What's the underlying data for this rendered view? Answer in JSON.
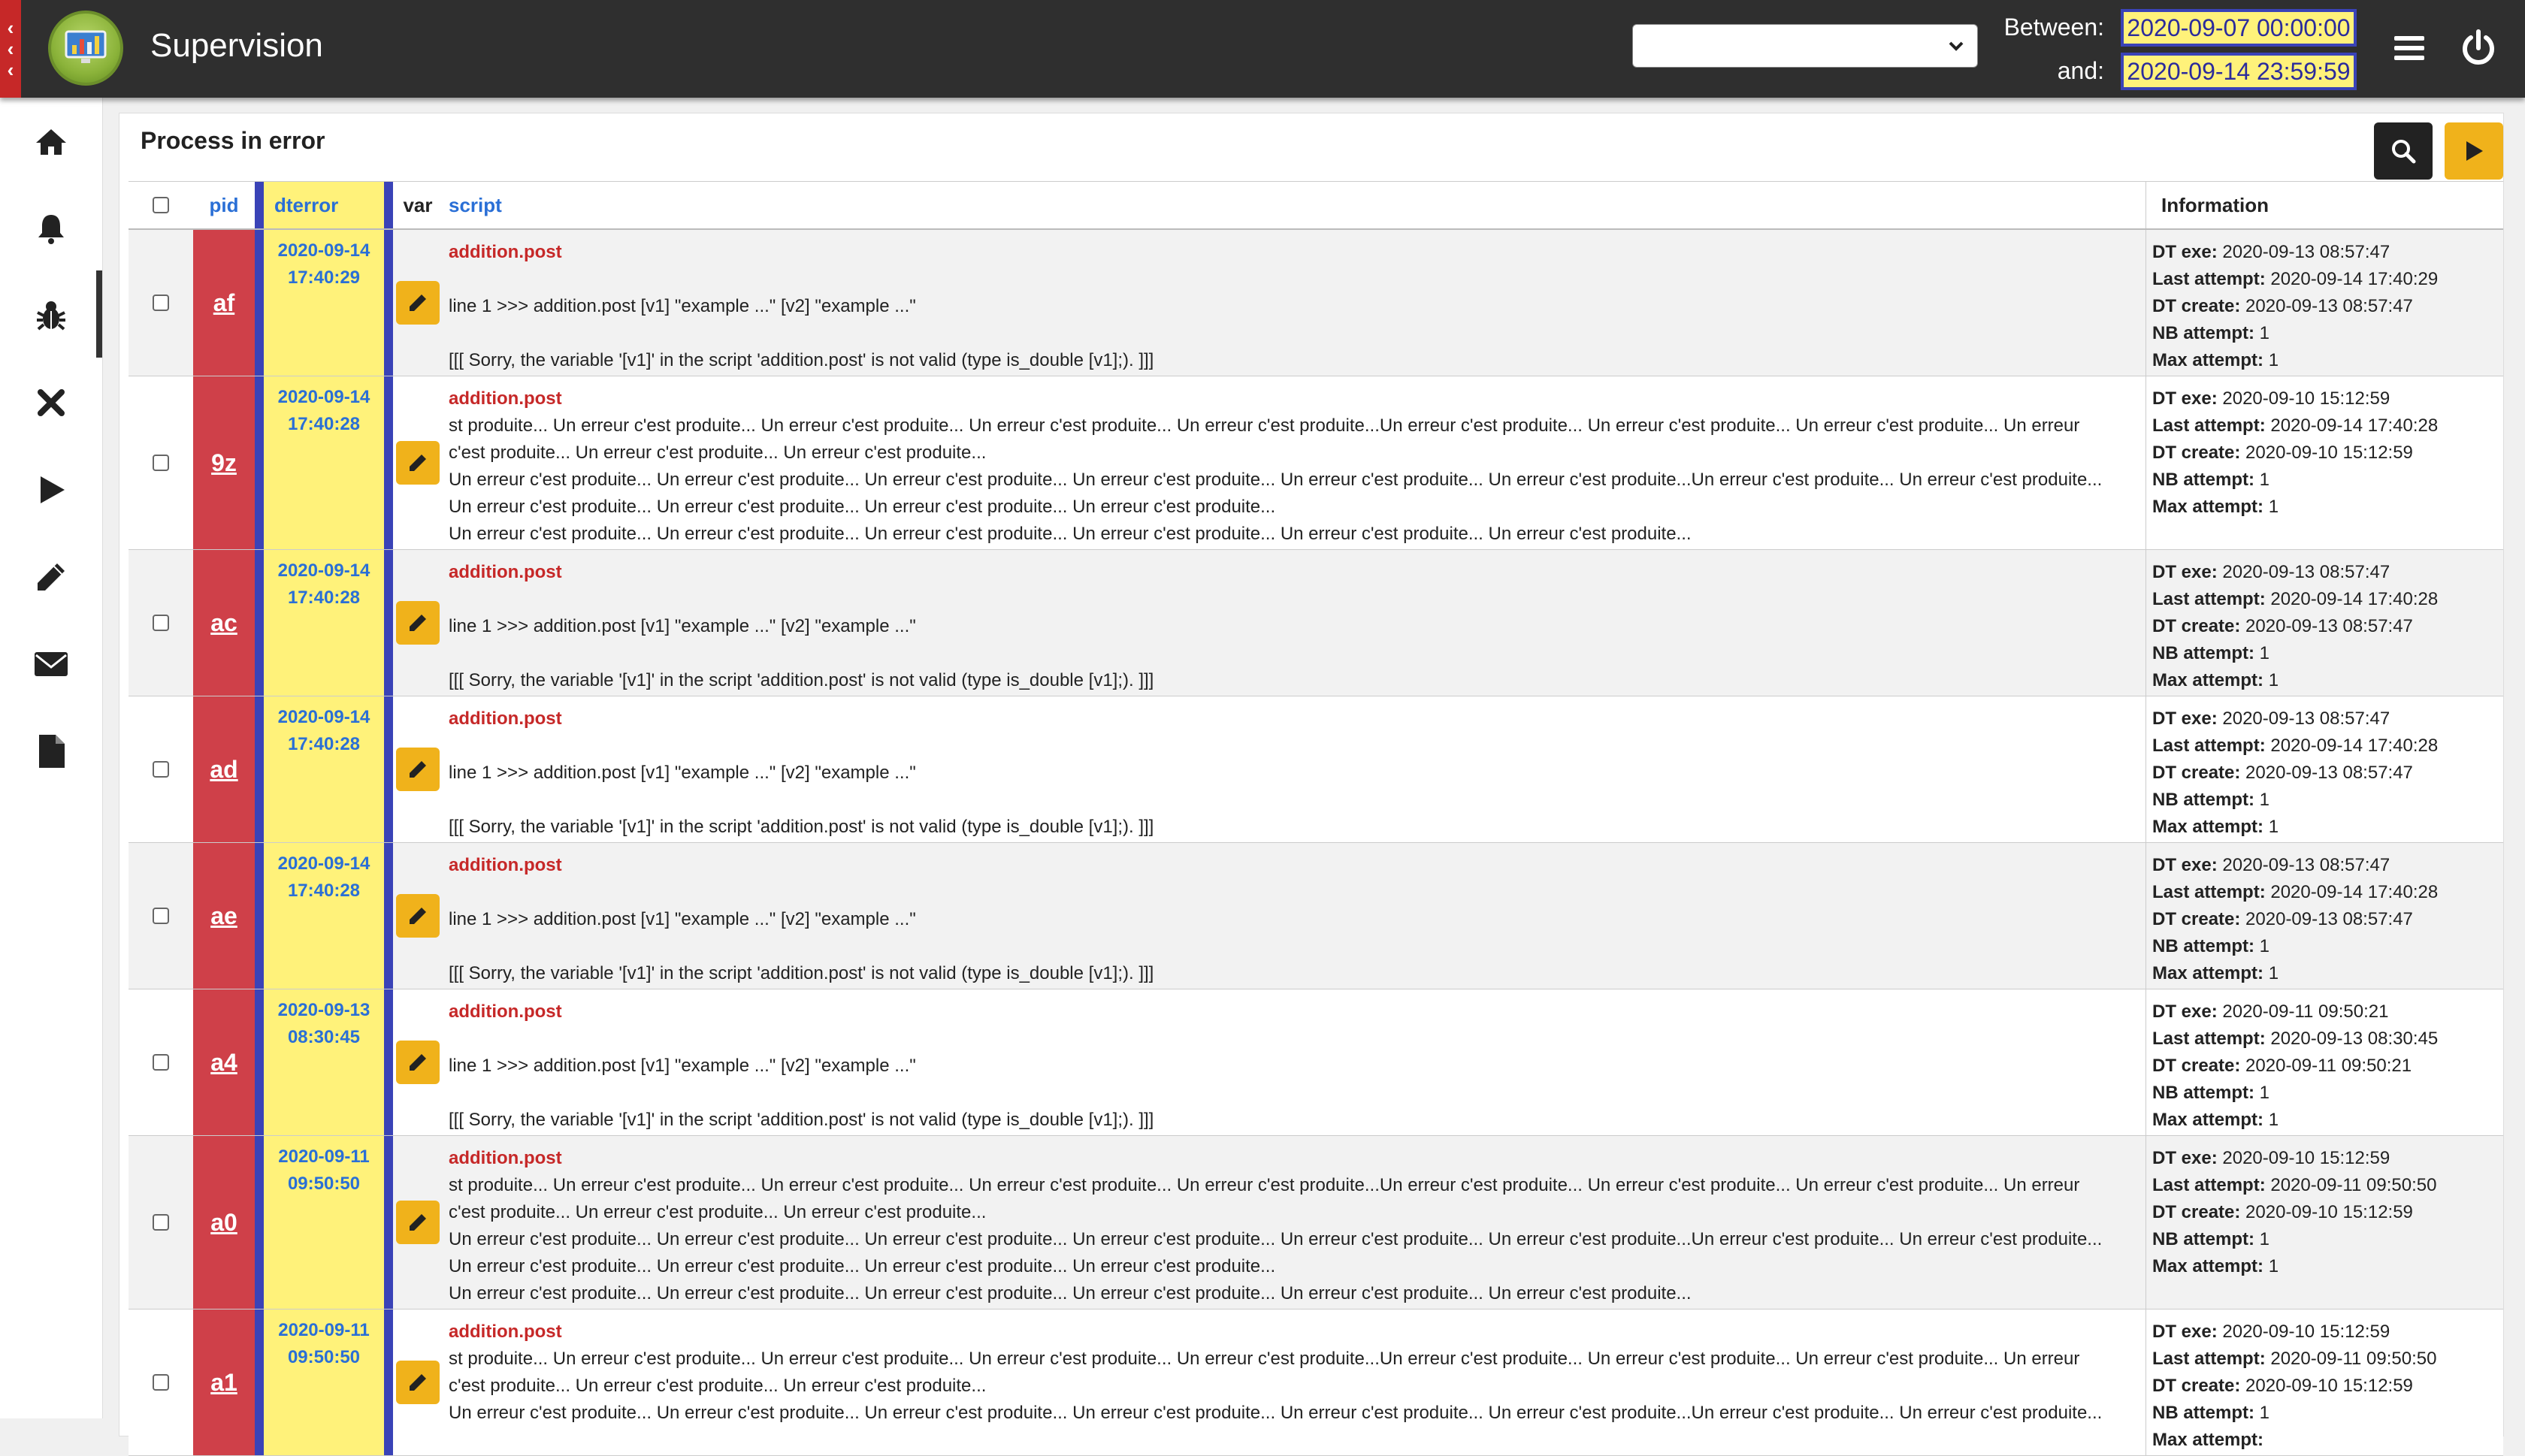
{
  "header": {
    "title": "Supervision",
    "select_value": "",
    "between_label": "Between:",
    "and_label": "and:",
    "date_from": "2020-09-07 00:00:00",
    "date_to": "2020-09-14 23:59:59"
  },
  "sidebar": {
    "items": [
      "home-icon",
      "bell-icon",
      "bug-icon",
      "close-icon",
      "play-icon",
      "pencil-icon",
      "envelope-icon",
      "file-icon"
    ],
    "active": "bug-icon"
  },
  "panel": {
    "title": "Process in error"
  },
  "table": {
    "columns": {
      "pid": "pid",
      "dterror": "dterror",
      "var": "var",
      "script": "script",
      "info": "Information"
    },
    "info_labels": {
      "dt_exe": "DT exe:",
      "last_attempt": "Last attempt:",
      "dt_create": "DT create:",
      "nb_attempt": "NB attempt:",
      "max_attempt": "Max attempt:"
    },
    "rows": [
      {
        "pid": "af",
        "dterror_date": "2020-09-14",
        "dterror_time": "17:40:29",
        "script_name": "addition.post",
        "lines": [
          "",
          "line 1 >>> addition.post [v1] \"example ...\" [v2] \"example ...\"",
          "",
          "[[[ Sorry, the variable '[v1]' in the script 'addition.post' is not valid (type is_double [v1];). ]]]"
        ],
        "dt_exe": "2020-09-13 08:57:47",
        "last_attempt": "2020-09-14 17:40:29",
        "dt_create": "2020-09-13 08:57:47",
        "nb_attempt": "1",
        "max_attempt": "1"
      },
      {
        "pid": "9z",
        "dterror_date": "2020-09-14",
        "dterror_time": "17:40:28",
        "script_name": "addition.post",
        "lines": [
          "st produite... Un erreur c'est produite... Un erreur c'est produite... Un erreur c'est produite... Un erreur c'est produite...Un erreur c'est produite... Un erreur c'est produite... Un erreur c'est produite... Un erreur",
          "c'est produite... Un erreur c'est produite... Un erreur c'est produite...",
          "Un erreur c'est produite... Un erreur c'est produite... Un erreur c'est produite... Un erreur c'est produite... Un erreur c'est produite... Un erreur c'est produite...Un erreur c'est produite... Un erreur c'est produite...",
          "Un erreur c'est produite... Un erreur c'est produite... Un erreur c'est produite... Un erreur c'est produite...",
          "Un erreur c'est produite... Un erreur c'est produite... Un erreur c'est produite... Un erreur c'est produite... Un erreur c'est produite... Un erreur c'est produite..."
        ],
        "dt_exe": "2020-09-10 15:12:59",
        "last_attempt": "2020-09-14 17:40:28",
        "dt_create": "2020-09-10 15:12:59",
        "nb_attempt": "1",
        "max_attempt": "1"
      },
      {
        "pid": "ac",
        "dterror_date": "2020-09-14",
        "dterror_time": "17:40:28",
        "script_name": "addition.post",
        "lines": [
          "",
          "line 1 >>> addition.post [v1] \"example ...\" [v2] \"example ...\"",
          "",
          "[[[ Sorry, the variable '[v1]' in the script 'addition.post' is not valid (type is_double [v1];). ]]]"
        ],
        "dt_exe": "2020-09-13 08:57:47",
        "last_attempt": "2020-09-14 17:40:28",
        "dt_create": "2020-09-13 08:57:47",
        "nb_attempt": "1",
        "max_attempt": "1"
      },
      {
        "pid": "ad",
        "dterror_date": "2020-09-14",
        "dterror_time": "17:40:28",
        "script_name": "addition.post",
        "lines": [
          "",
          "line 1 >>> addition.post [v1] \"example ...\" [v2] \"example ...\"",
          "",
          "[[[ Sorry, the variable '[v1]' in the script 'addition.post' is not valid (type is_double [v1];). ]]]"
        ],
        "dt_exe": "2020-09-13 08:57:47",
        "last_attempt": "2020-09-14 17:40:28",
        "dt_create": "2020-09-13 08:57:47",
        "nb_attempt": "1",
        "max_attempt": "1"
      },
      {
        "pid": "ae",
        "dterror_date": "2020-09-14",
        "dterror_time": "17:40:28",
        "script_name": "addition.post",
        "lines": [
          "",
          "line 1 >>> addition.post [v1] \"example ...\" [v2] \"example ...\"",
          "",
          "[[[ Sorry, the variable '[v1]' in the script 'addition.post' is not valid (type is_double [v1];). ]]]"
        ],
        "dt_exe": "2020-09-13 08:57:47",
        "last_attempt": "2020-09-14 17:40:28",
        "dt_create": "2020-09-13 08:57:47",
        "nb_attempt": "1",
        "max_attempt": "1"
      },
      {
        "pid": "a4",
        "dterror_date": "2020-09-13",
        "dterror_time": "08:30:45",
        "script_name": "addition.post",
        "lines": [
          "",
          "line 1 >>> addition.post [v1] \"example ...\" [v2] \"example ...\"",
          "",
          "[[[ Sorry, the variable '[v1]' in the script 'addition.post' is not valid (type is_double [v1];). ]]]"
        ],
        "dt_exe": "2020-09-11 09:50:21",
        "last_attempt": "2020-09-13 08:30:45",
        "dt_create": "2020-09-11 09:50:21",
        "nb_attempt": "1",
        "max_attempt": "1"
      },
      {
        "pid": "a0",
        "dterror_date": "2020-09-11",
        "dterror_time": "09:50:50",
        "script_name": "addition.post",
        "lines": [
          "st produite... Un erreur c'est produite... Un erreur c'est produite... Un erreur c'est produite... Un erreur c'est produite...Un erreur c'est produite... Un erreur c'est produite... Un erreur c'est produite... Un erreur",
          "c'est produite... Un erreur c'est produite... Un erreur c'est produite...",
          "Un erreur c'est produite... Un erreur c'est produite... Un erreur c'est produite... Un erreur c'est produite... Un erreur c'est produite... Un erreur c'est produite...Un erreur c'est produite... Un erreur c'est produite...",
          "Un erreur c'est produite... Un erreur c'est produite... Un erreur c'est produite... Un erreur c'est produite...",
          "Un erreur c'est produite... Un erreur c'est produite... Un erreur c'est produite... Un erreur c'est produite... Un erreur c'est produite... Un erreur c'est produite..."
        ],
        "dt_exe": "2020-09-10 15:12:59",
        "last_attempt": "2020-09-11 09:50:50",
        "dt_create": "2020-09-10 15:12:59",
        "nb_attempt": "1",
        "max_attempt": "1"
      },
      {
        "pid": "a1",
        "dterror_date": "2020-09-11",
        "dterror_time": "09:50:50",
        "script_name": "addition.post",
        "lines": [
          "st produite... Un erreur c'est produite... Un erreur c'est produite... Un erreur c'est produite... Un erreur c'est produite...Un erreur c'est produite... Un erreur c'est produite... Un erreur c'est produite... Un erreur",
          "c'est produite... Un erreur c'est produite... Un erreur c'est produite...",
          "Un erreur c'est produite... Un erreur c'est produite... Un erreur c'est produite... Un erreur c'est produite... Un erreur c'est produite... Un erreur c'est produite...Un erreur c'est produite... Un erreur c'est produite..."
        ],
        "dt_exe": "2020-09-10 15:12:59",
        "last_attempt": "2020-09-11 09:50:50",
        "dt_create": "2020-09-10 15:12:59",
        "nb_attempt": "1",
        "max_attempt": ""
      }
    ]
  }
}
